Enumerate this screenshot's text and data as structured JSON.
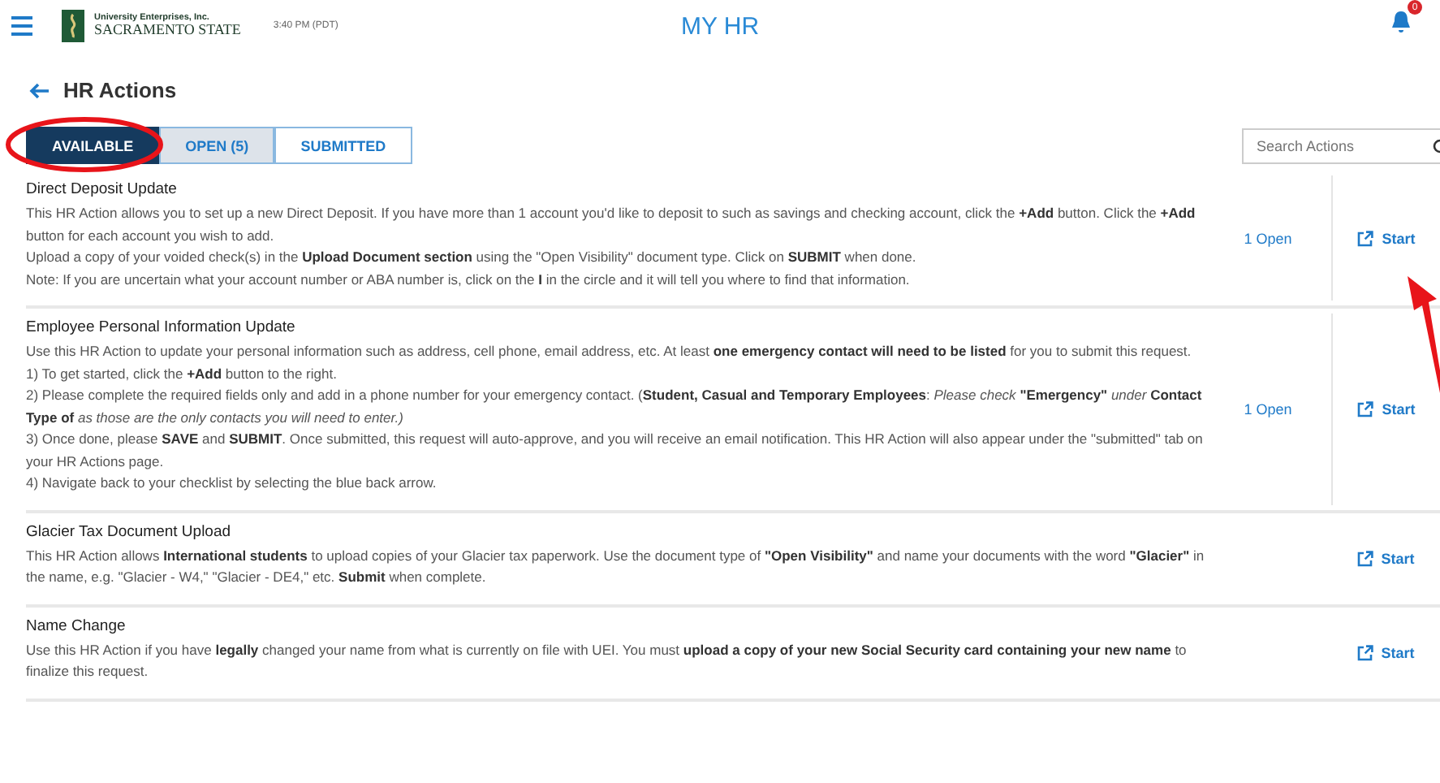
{
  "header": {
    "logo_small": "University Enterprises, Inc.",
    "logo_large": "SACRAMENTO STATE",
    "time": "3:40 PM (PDT)",
    "title": "MY HR",
    "notifications": "0"
  },
  "page_title": "HR Actions",
  "tabs": [
    {
      "label": "AVAILABLE",
      "selected": true,
      "highlighted": false
    },
    {
      "label": "OPEN (5)",
      "selected": false,
      "highlighted": true
    },
    {
      "label": "SUBMITTED",
      "selected": false,
      "highlighted": false
    }
  ],
  "search": {
    "placeholder": "Search Actions"
  },
  "actions": [
    {
      "title": "Direct Deposit Update",
      "paragraphs": [
        "This HR Action allows you to set up a new Direct Deposit. If you have more than 1 account you'd like to deposit to such as savings and checking account, click the  **+Add** button.  Click the **+Add** button for each account you wish to add.",
        "Upload a copy of your voided check(s) in the **Upload Document section** using the \"Open Visibility\" document type.  Click on **SUBMIT** when done.",
        "Note: If you are uncertain what your account number or ABA number is, click on the **I** in the circle and it will tell you where to find that information."
      ],
      "count": "1 Open",
      "start": "Start"
    },
    {
      "title": "Employee Personal Information Update",
      "paragraphs": [
        "Use this HR Action to update your personal information such as address, cell phone, email address, etc. At least **one emergency contact will need to be listed** for you to submit this request.",
        "1) To get started, click the **+Add** button to the right.",
        "2) Please complete the required fields only and add in a phone number for your emergency contact. (**Student, Casual and Temporary Employees**: *Please check* **\"Emergency\"** *under* **Contact Type of** *as those are the only contacts you will need to enter.)*",
        "3) Once done, please **SAVE** and **SUBMIT**. Once submitted, this request will auto-approve, and you will receive an email notification. This HR Action will also appear under the \"submitted\" tab on your HR Actions page.",
        "4) Navigate back to your checklist by selecting the blue back arrow."
      ],
      "count": "1 Open",
      "start": "Start"
    },
    {
      "title": "Glacier Tax Document Upload",
      "paragraphs": [
        "This HR Action allows **International students** to upload copies of your Glacier tax paperwork. Use the document type of **\"Open Visibility\"** and name your documents with the word **\"Glacier\"** in the name, e.g. \"Glacier - W4,\" \"Glacier - DE4,\" etc. **Submit** when complete."
      ],
      "start": "Start"
    },
    {
      "title": "Name Change",
      "paragraphs": [
        "Use this HR Action if you have **legally** changed your name from what is currently on file with UEI. You must **upload a copy of your new Social Security card containing your new name** to finalize this request."
      ],
      "start": "Start"
    }
  ]
}
